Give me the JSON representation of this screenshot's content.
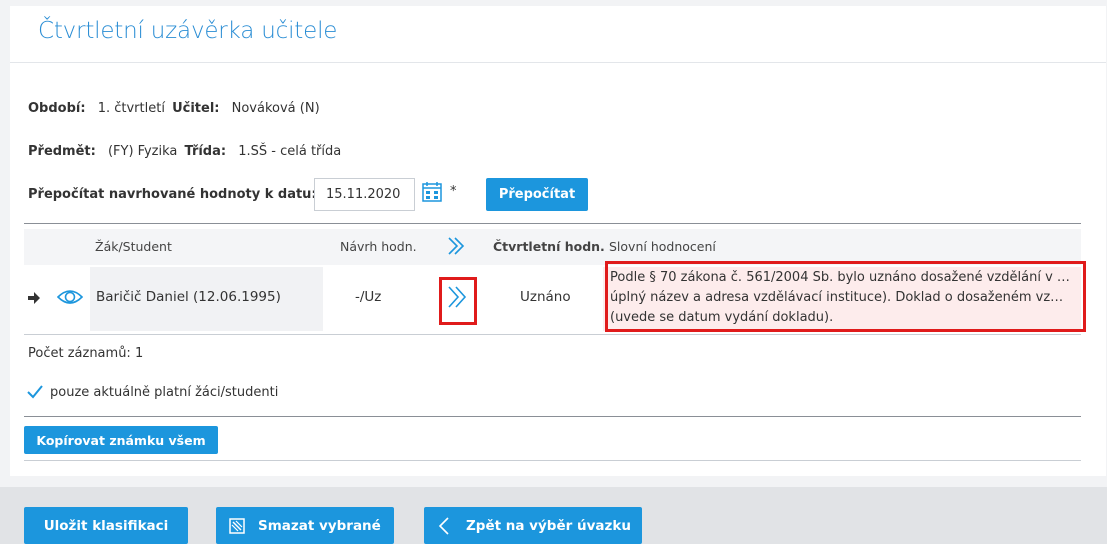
{
  "page": {
    "title": "Čtvrtletní uzávěrka učitele"
  },
  "info": {
    "obdobi_label": "Období:",
    "obdobi_value": "1. čtvrtletí",
    "ucitel_label": "Učitel:",
    "ucitel_value": "Nováková (N)",
    "predmet_label": "Předmět:",
    "predmet_value": "(FY) Fyzika",
    "trida_label": "Třída:",
    "trida_value": "1.SŠ - celá třída",
    "prepocitat_label": "Přepočítat navrhované hodnoty k datu:",
    "date_value": "15.11.2020",
    "required_mark": "*",
    "prepocitat_button": "Přepočítat"
  },
  "table": {
    "headers": {
      "student": "Žák/Student",
      "navrh": "Návrh hodn.",
      "ctvrtletni": "Čtvrtletní hodn.",
      "slovni": "Slovní hodnocení"
    },
    "rows": [
      {
        "student": "Baričič Daniel (12.06.1995)",
        "navrh": "-/Uz",
        "ctvrtletni": "Uznáno",
        "slovni_lines": [
          "Podle § 70 zákona č. 561/2004 Sb. bylo uznáno dosažené vzdělání v …",
          "úplný název a adresa vzdělávací instituce). Doklad o dosaženém vz…",
          "(uvede se datum vydání dokladu)."
        ]
      }
    ]
  },
  "count_text": "Počet záznamů: 1",
  "filter_label": "pouze aktuálně platní žáci/studenti",
  "copy_button": "Kopírovat známku všem",
  "footer": {
    "save_button": "Uložit klasifikaci",
    "delete_button": "Smazat vybrané",
    "back_button": "Zpět na výběr úvazku"
  },
  "colors": {
    "accent": "#1c96dd",
    "highlight": "#e01b1b",
    "title": "#2a8dd4"
  },
  "icons": [
    "calendar-icon",
    "row-arrow-icon",
    "eye-icon",
    "double-chevron-icon",
    "checkmark-icon",
    "eraser-icon",
    "chevron-left-icon"
  ]
}
